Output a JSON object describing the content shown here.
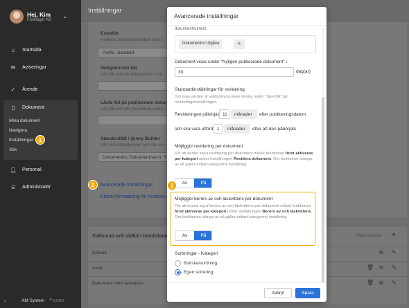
{
  "sidebar": {
    "user_name": "Hej, Kim",
    "company": "Företaget AB",
    "nav": [
      {
        "label": "Startsida",
        "icon": "home-icon"
      },
      {
        "label": "Aviseringar",
        "icon": "mail-icon"
      },
      {
        "label": "Ärende",
        "icon": "check-icon"
      },
      {
        "label": "Dokument",
        "icon": "document-icon"
      },
      {
        "label": "Personal",
        "icon": "person-icon"
      },
      {
        "label": "Administratör",
        "icon": "bank-icon"
      }
    ],
    "sub_items": [
      "Mina dokument",
      "Navigera",
      "Inställningar",
      "Sök"
    ],
    "footer": "AM System",
    "footer_version": "6.2.007"
  },
  "page": {
    "title": "Inställningar",
    "sections": [
      {
        "label": "Extrafält",
        "help": "Hantera utökad information som k"
      },
      {
        "label": "Obligatoriska fält",
        "help": "Välj fält som på dokumenten som"
      },
      {
        "label": "Låsta fält på publicerade dokument",
        "help": "Välj fält som inte ska kunna ändra"
      },
      {
        "label": "Standardfält i Query Builder",
        "help": "Välj vilka fältkolumner som ska vis"
      }
    ],
    "field_value": "Prefix, standard",
    "query_value": "Dokumentnr, Dokumentnamn, S",
    "links": [
      "Avancerade inställningar",
      "Global formatering för textdoku"
    ],
    "headfoot": {
      "title": "Sidhuvud och sidfot i textdokumen",
      "total": "Totalt 3 poster",
      "rows": [
        "Default",
        "Avtal",
        "Dokument med sekretess"
      ]
    }
  },
  "badges": [
    "1",
    "2",
    "3"
  ],
  "modal": {
    "title": "Avancerade inställningar",
    "partial_top": "dokumentnumret",
    "chip": "Dokumentnr:Utgåva",
    "plus": "+",
    "recent_label": "Dokument visas under \"Nyligen publicerade dokument\" i",
    "recent_value": "30",
    "recent_unit": "dag(ar)",
    "revision_title": "Standardinställningar för revidering",
    "revision_help": "Om inga värden är valda/ärvda visas denna under \"Specifik\" på revideringsinställningen",
    "rev_line1_pre": "Revideringen påbörjas",
    "rev_line1_num": "11",
    "rev_line1_unit": "månader",
    "rev_line1_post": "efter publiceringsdatum",
    "rev_line2_pre": "och ska vara utförd",
    "rev_line2_num": "1",
    "rev_line2_unit": "månader",
    "rev_line2_post": "efter att den påbörjats.",
    "enable_rev_title": "Möjliggör revidering per dokument",
    "enable_rev_help_1": "För att kunna styra revidering per dokument måste funktionen ",
    "enable_rev_help_b1": "först aktiveras per kategori",
    "enable_rev_help_2": " under inställningen ",
    "enable_rev_help_b2": "Revidera dokument",
    "enable_rev_help_3": ". Om funktionen stängs av så gäller enbart kategorins inställning.",
    "toggle_off": "Av",
    "toggle_on": "På",
    "readers_title": "Möjliggör berörs av och läskvittens per dokument",
    "readers_help_1": "För att kunna styra berörs av och läskvittens per dokument måste funktionen ",
    "readers_help_b1": "först aktiveras per kategori",
    "readers_help_2": " under inställningen ",
    "readers_help_b2": "Berörs av och läskvittens",
    "readers_help_3": ". Om funktionen stängs av så gäller enbart kategorins inställning.",
    "sort_title": "Sorteringar - Kategori",
    "sort_options": [
      "Bokstavsordning",
      "Egen sortering"
    ],
    "cancel": "Avbryt",
    "save": "Spara"
  },
  "colors": {
    "accent": "#2a73d9",
    "highlight": "#f2a800",
    "sidebar": "#2a2a2a"
  }
}
